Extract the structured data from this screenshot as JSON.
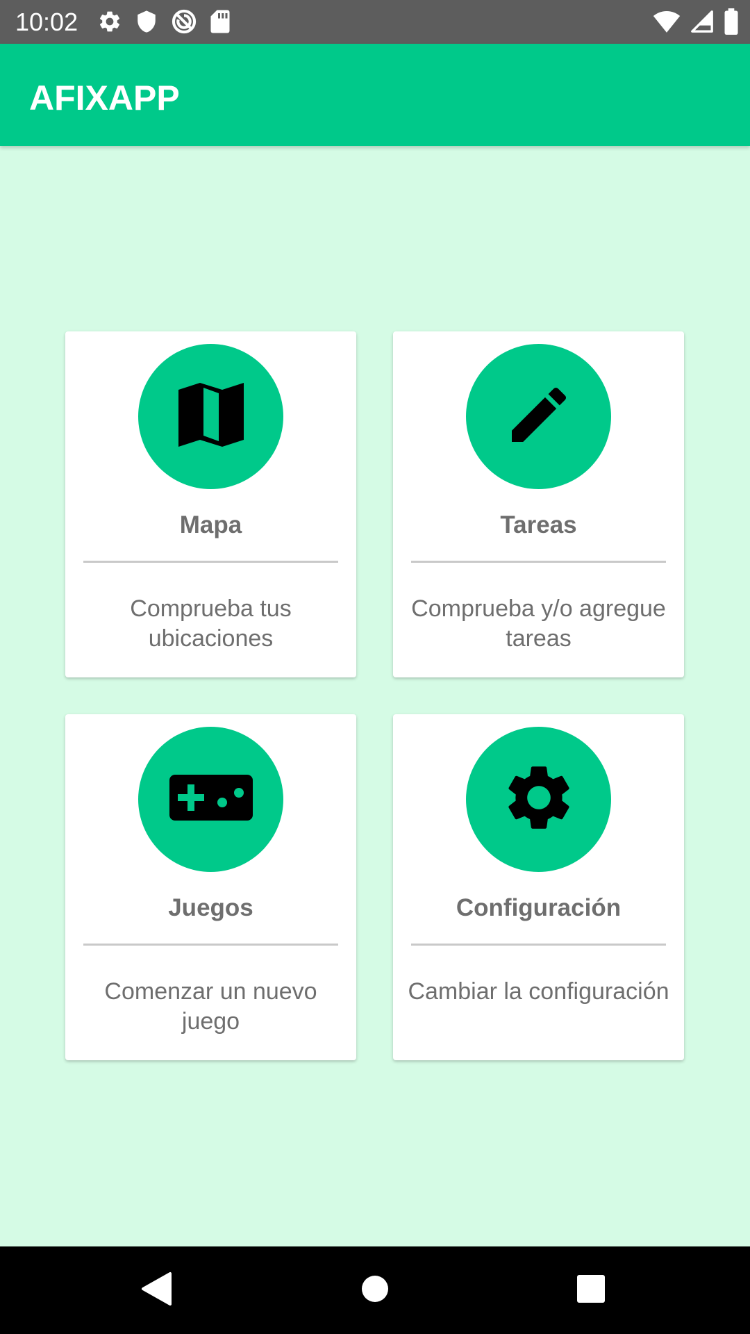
{
  "status_bar": {
    "time": "10:02",
    "left_icons": [
      "gear-icon",
      "shield-icon",
      "no-sync-icon",
      "sd-card-icon"
    ],
    "right_icons": [
      "wifi-icon",
      "signal-icon",
      "battery-icon"
    ]
  },
  "app_bar": {
    "title": "AFIXAPP",
    "color": "#00c98a"
  },
  "cards": [
    {
      "title": "Mapa",
      "description": "Comprueba tus ubicaciones",
      "icon": "map-icon"
    },
    {
      "title": "Tareas",
      "description": "Comprueba y/o agregue tareas",
      "icon": "pencil-icon"
    },
    {
      "title": "Juegos",
      "description": "Comenzar un nuevo juego",
      "icon": "gamepad-icon"
    },
    {
      "title": "Configuración",
      "description": "Cambiar la configuración",
      "icon": "settings-icon"
    }
  ],
  "nav_bar": {
    "buttons": [
      "back-icon",
      "home-icon",
      "recents-icon"
    ]
  },
  "colors": {
    "accent": "#00c98a",
    "background": "#d5fbe5",
    "text": "#6e6e6e"
  }
}
